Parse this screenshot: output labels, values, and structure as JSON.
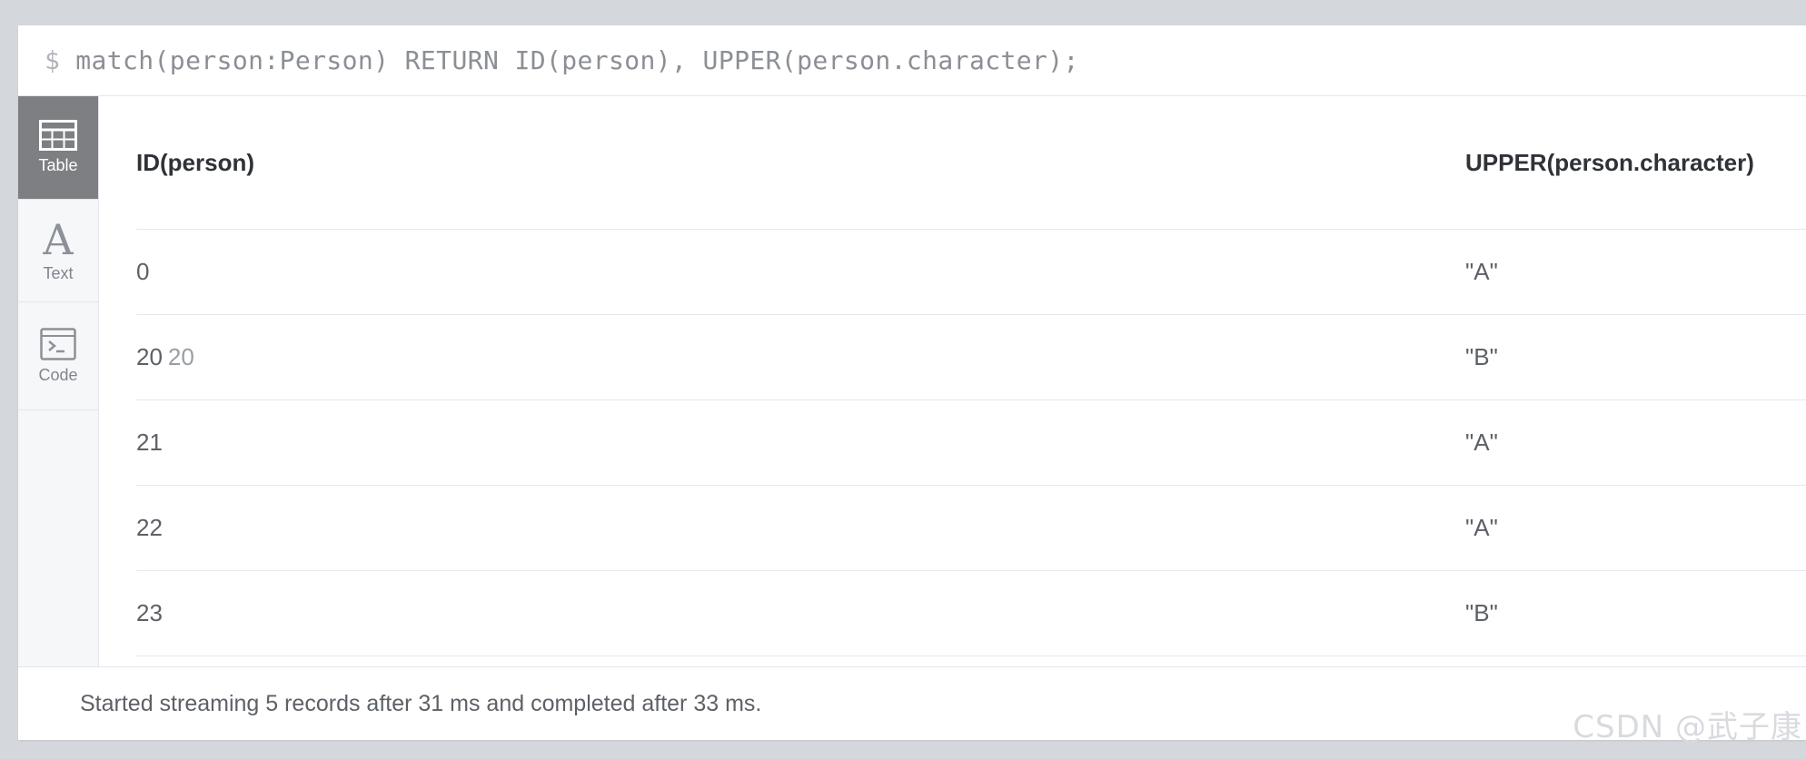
{
  "query": {
    "prompt": "$",
    "text": "match(person:Person) RETURN ID(person), UPPER(person.character);"
  },
  "sidebar": {
    "tabs": [
      {
        "label": "Table",
        "icon": "table-icon",
        "active": true
      },
      {
        "label": "Text",
        "icon": "text-icon",
        "active": false
      },
      {
        "label": "Code",
        "icon": "code-icon",
        "active": false
      }
    ]
  },
  "table": {
    "columns": [
      "ID(person)",
      "UPPER(person.character)"
    ],
    "rows": [
      {
        "id": "0",
        "id_extra": "",
        "value": "\"A\""
      },
      {
        "id": "20",
        "id_extra": "20",
        "value": "\"B\""
      },
      {
        "id": "21",
        "id_extra": "",
        "value": "\"A\""
      },
      {
        "id": "22",
        "id_extra": "",
        "value": "\"A\""
      },
      {
        "id": "23",
        "id_extra": "",
        "value": "\"B\""
      }
    ]
  },
  "status": {
    "text": "Started streaming 5 records after 31 ms and completed after 33 ms."
  },
  "watermark": {
    "text": "CSDN @武子康"
  },
  "colors": {
    "active_tab_bg": "#7d7f82",
    "sidebar_bg": "#f6f7f9",
    "border": "#e3e6ea"
  }
}
